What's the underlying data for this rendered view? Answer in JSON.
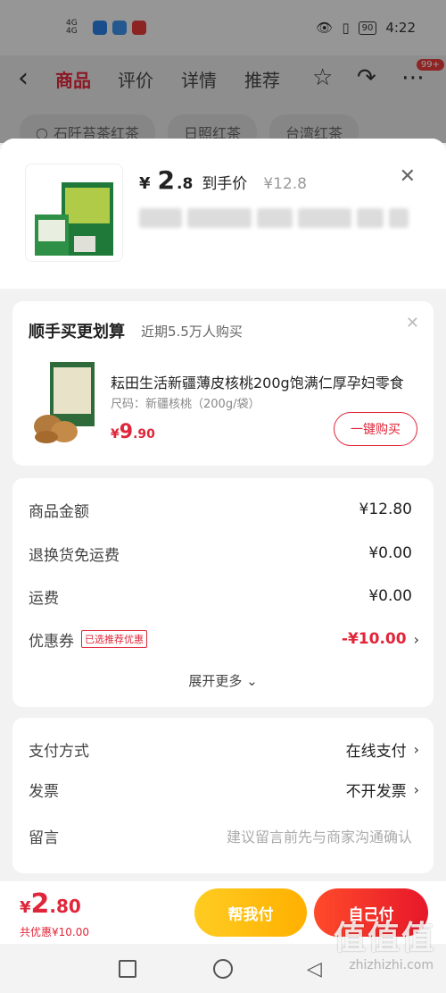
{
  "status": {
    "network": "4G 4G",
    "battery": "90",
    "time": "4:22"
  },
  "nav": {
    "tabs": [
      "商品",
      "评价",
      "详情",
      "推荐"
    ],
    "badge": "99+"
  },
  "chips": [
    "石阡苔茶红茶",
    "日照红茶",
    "台湾红茶"
  ],
  "sheet": {
    "price_yen": "¥",
    "price_int": "2",
    "price_dec": ".8",
    "price_label": "到手价",
    "orig_price": "¥12.8"
  },
  "addon": {
    "title": "顺手买更划算",
    "subtitle": "近期5.5万人购买",
    "product_name": "耘田生活新疆薄皮核桃200g饱满仁厚孕妇零食",
    "spec": "尺码：新疆核桃（200g/袋）",
    "price_yen": "¥",
    "price_int": "9",
    "price_dec": ".90",
    "buy_label": "一键购买"
  },
  "costs": {
    "rows": [
      {
        "label": "商品金额",
        "value": "¥12.80"
      },
      {
        "label": "退换货免运费",
        "value": "¥0.00"
      },
      {
        "label": "运费",
        "value": "¥0.00"
      }
    ],
    "coupon_label": "优惠券",
    "coupon_tag": "已选推荐优惠",
    "coupon_value": "-¥10.00",
    "expand_label": "展开更多"
  },
  "options": {
    "payment_label": "支付方式",
    "payment_value": "在线支付",
    "invoice_label": "发票",
    "invoice_value": "不开发票",
    "message_label": "留言",
    "message_placeholder": "建议留言前先与商家沟通确认"
  },
  "bottom": {
    "total_yen": "¥",
    "total_int": "2",
    "total_dec": ".80",
    "discount": "共优惠¥10.00",
    "help_pay": "帮我付",
    "self_pay": "自己付"
  },
  "watermark": "值值值",
  "watermark_url": "zhizhizhi.com"
}
